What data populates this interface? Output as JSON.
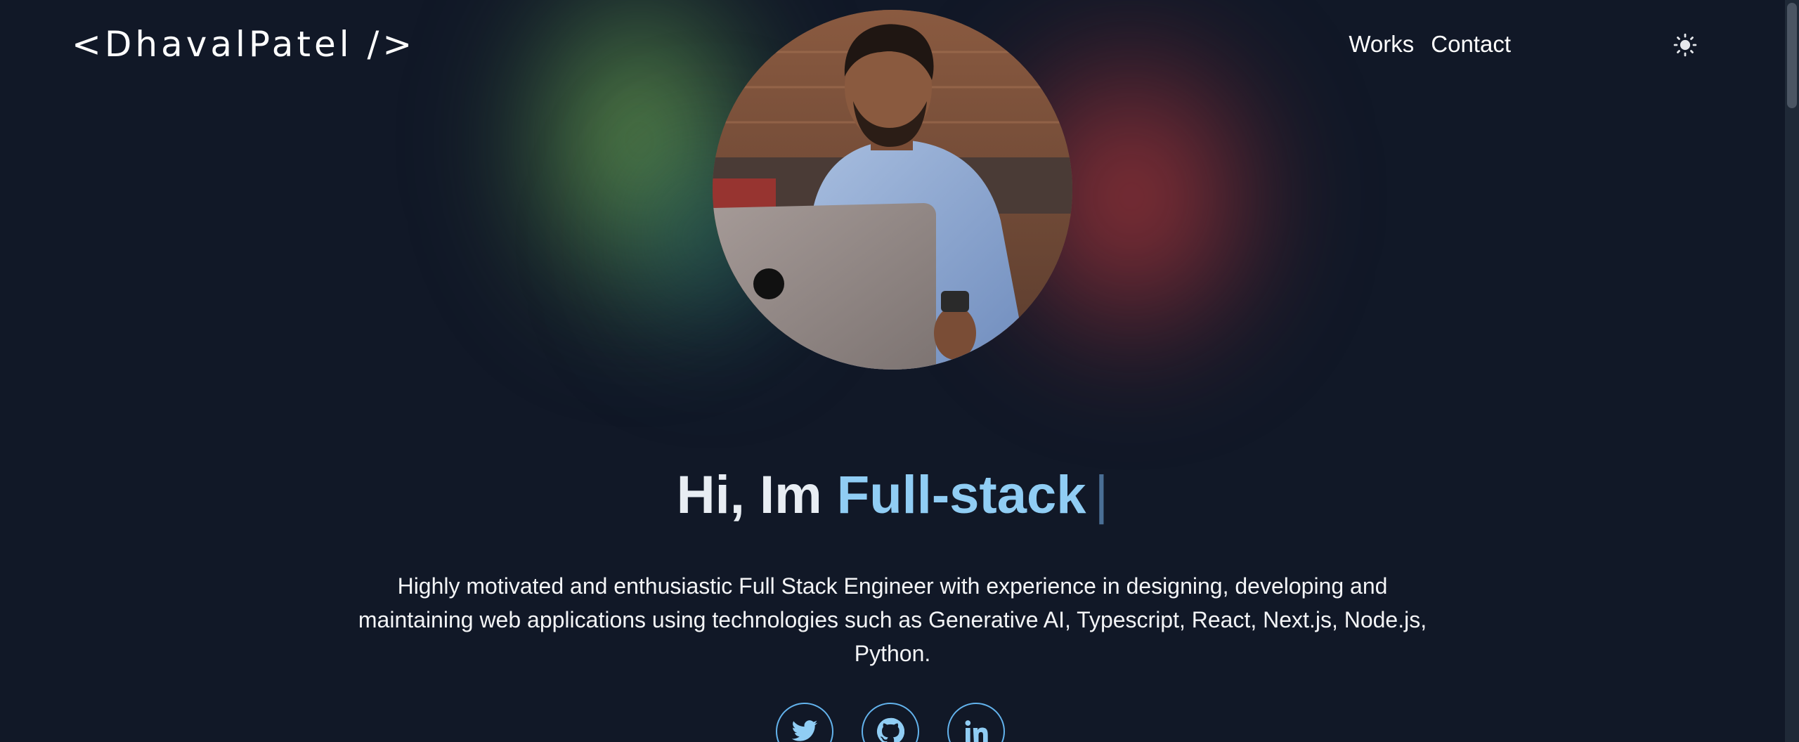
{
  "header": {
    "logo": "<DhavalPatel />",
    "nav": [
      {
        "label": "Works"
      },
      {
        "label": "Contact"
      }
    ],
    "theme_toggle_icon": "sun-icon"
  },
  "hero": {
    "avatar_icon": "profile-photo",
    "greeting": "Hi, Im",
    "role": "Full-stack",
    "cursor": "|",
    "bio": "Highly motivated and enthusiastic Full Stack Engineer with experience in designing, developing and maintaining web applications using technologies such as Generative AI, Typescript, React, Next.js, Node.js, Python."
  },
  "socials": [
    {
      "icon": "twitter-icon"
    },
    {
      "icon": "github-icon"
    },
    {
      "icon": "linkedin-icon"
    }
  ],
  "colors": {
    "background": "#111827",
    "accent": "#90cdf4",
    "social_border": "#63b3ed"
  }
}
